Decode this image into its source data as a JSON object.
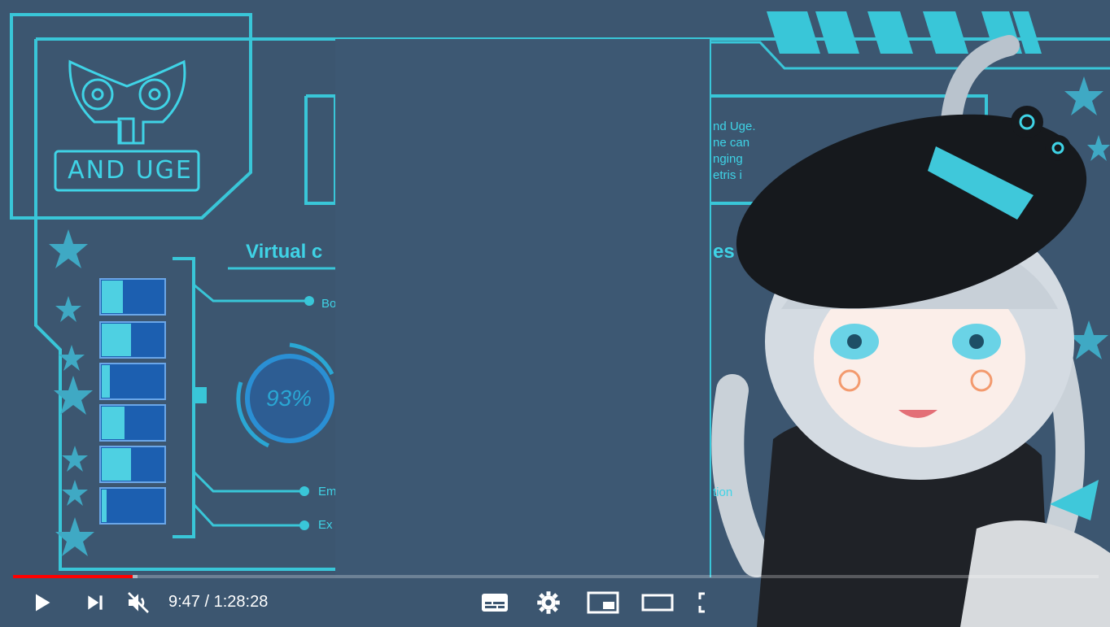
{
  "brand": {
    "logo_text": "AND UGE"
  },
  "hud": {
    "virtual_label": "Virtual c",
    "gauge_value": "93%",
    "left_labels": [
      "Bo",
      "Em",
      "Ex"
    ],
    "right_text_lines": [
      "nd Uge.",
      "ne can",
      "nging",
      "etris i"
    ],
    "right_tab": "es",
    "right_small": "tion"
  },
  "player": {
    "current_time": "9:47",
    "separator": " / ",
    "duration": "1:28:28",
    "progress_played_fraction": 0.11,
    "progress_buffered_fraction": 0.115,
    "muted": true
  },
  "controls": {
    "play_icon": "play-icon",
    "next_icon": "next-icon",
    "mute_icon": "volume-muted-icon",
    "subtitles_icon": "subtitles-icon",
    "settings_icon": "gear-icon",
    "miniplayer_icon": "miniplayer-icon",
    "theater_icon": "theater-mode-icon",
    "fullscreen_icon": "fullscreen-icon"
  },
  "colors": {
    "background": "#3c5670",
    "accent": "#3fd3e6",
    "progress": "#ff0000"
  }
}
